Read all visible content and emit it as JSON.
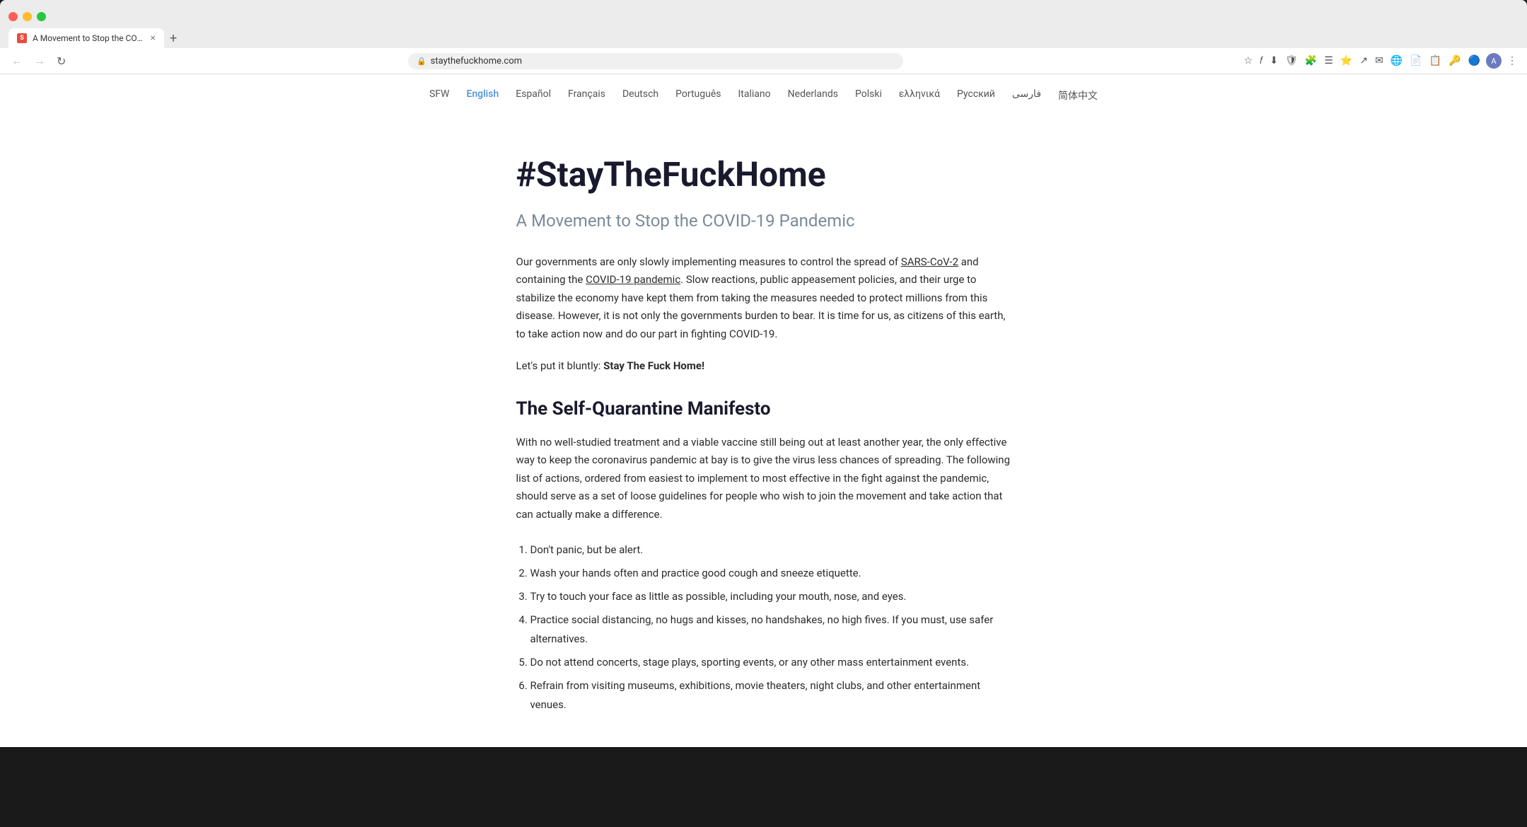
{
  "browser": {
    "tab_title": "A Movement to Stop the COVI...",
    "url": "staythefuckhome.com",
    "new_tab_label": "+"
  },
  "nav": {
    "links": [
      {
        "label": "SFW",
        "active": false
      },
      {
        "label": "English",
        "active": true
      },
      {
        "label": "Español",
        "active": false
      },
      {
        "label": "Français",
        "active": false
      },
      {
        "label": "Deutsch",
        "active": false
      },
      {
        "label": "Português",
        "active": false
      },
      {
        "label": "Italiano",
        "active": false
      },
      {
        "label": "Nederlands",
        "active": false
      },
      {
        "label": "Polski",
        "active": false
      },
      {
        "label": "ελληνικά",
        "active": false
      },
      {
        "label": "Русский",
        "active": false
      },
      {
        "label": "فارسی",
        "active": false
      },
      {
        "label": "简体中文",
        "active": false
      }
    ]
  },
  "page": {
    "main_title": "#StayTheFuckHome",
    "subtitle": "A Movement to Stop the COVID-19 Pandemic",
    "intro_paragraph": "Our governments are only slowly implementing measures to control the spread of SARS-CoV-2 and containing the COVID-19 pandemic. Slow reactions, public appeasement policies, and their urge to stabilize the economy have kept them from taking the measures needed to protect millions from this disease. However, it is not only the governments burden to bear. It is time for us, as citizens of this earth, to take action now and do our part in fighting COVID-19.",
    "bluntly_prefix": "Let's put it bluntly: ",
    "bluntly_bold": "Stay The Fuck Home!",
    "section_title": "The Self-Quarantine Manifesto",
    "manifesto_paragraph": "With no well-studied treatment and a viable vaccine still being out at least another year, the only effective way to keep the coronavirus pandemic at bay is to give the virus less chances of spreading. The following list of actions, ordered from easiest to implement to most effective in the fight against the pandemic, should serve as a set of loose guidelines for people who wish to join the movement and take action that can actually make a difference.",
    "list_items": [
      "Don't panic, but be alert.",
      "Wash your hands often and practice good cough and sneeze etiquette.",
      "Try to touch your face as little as possible, including your mouth, nose, and eyes.",
      "Practice social distancing, no hugs and kisses, no handshakes, no high fives. If you must, use safer alternatives.",
      "Do not attend concerts, stage plays, sporting events, or any other mass entertainment events.",
      "Refrain from visiting museums, exhibitions, movie theaters, night clubs, and other entertainment venues."
    ]
  }
}
